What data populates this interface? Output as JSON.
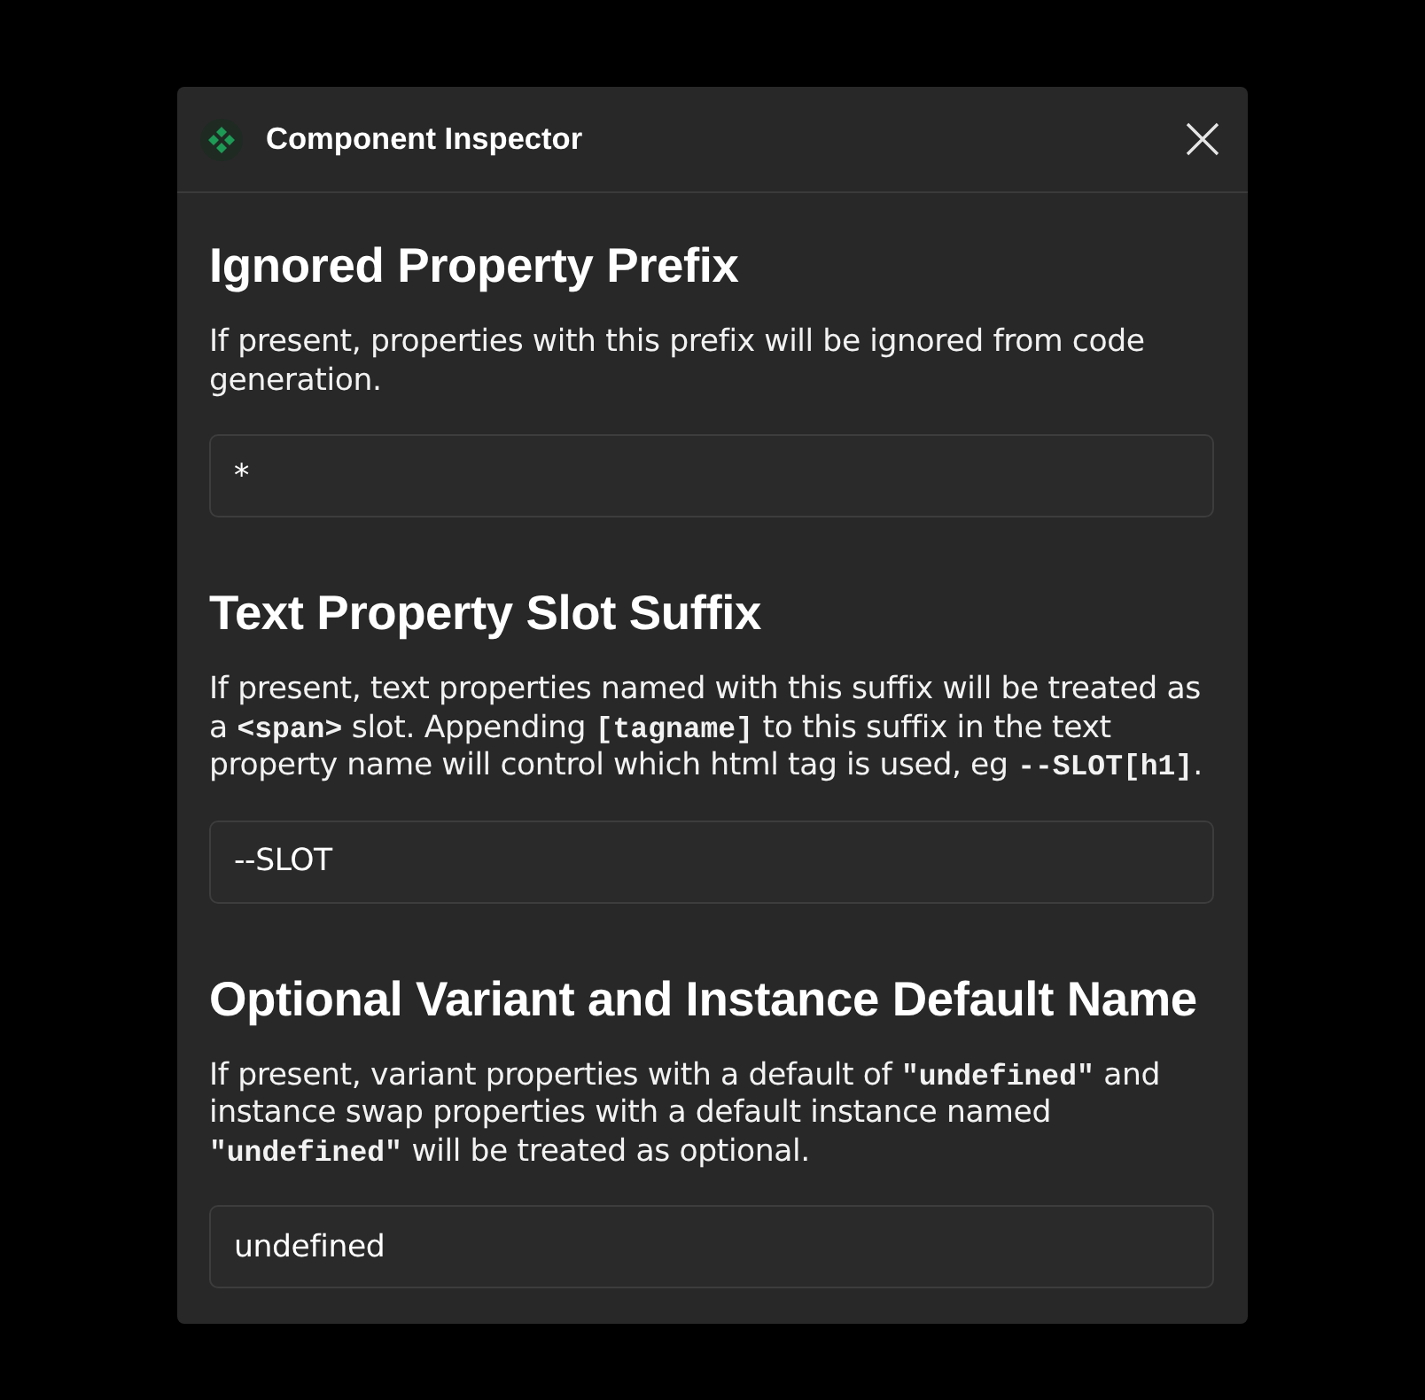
{
  "window": {
    "title": "Component Inspector"
  },
  "sections": [
    {
      "heading": "Ignored Property Prefix",
      "description": [
        {
          "kind": "text",
          "text": "If present, properties with this prefix will be ignored from code generation."
        }
      ],
      "field": {
        "value": "*"
      }
    },
    {
      "heading": "Text Property Slot Suffix",
      "description": [
        {
          "kind": "text",
          "text": "If present, text properties named with this suffix will be treated as a "
        },
        {
          "kind": "code",
          "text": "<span>"
        },
        {
          "kind": "text",
          "text": " slot. Appending "
        },
        {
          "kind": "code",
          "text": "[tagname]"
        },
        {
          "kind": "text",
          "text": " to this suffix in the text property name will control which html tag is used, eg "
        },
        {
          "kind": "code",
          "text": "--SLOT[h1]"
        },
        {
          "kind": "text",
          "text": "."
        }
      ],
      "field": {
        "value": "--SLOT"
      }
    },
    {
      "heading": "Optional Variant and Instance Default Name",
      "description": [
        {
          "kind": "text",
          "text": "If present, variant properties with a default of "
        },
        {
          "kind": "code",
          "text": "\"undefined\""
        },
        {
          "kind": "text",
          "text": " and instance swap properties with a default instance named "
        },
        {
          "kind": "code",
          "text": "\"undefined\""
        },
        {
          "kind": "text",
          "text": " will be treated as optional."
        }
      ],
      "field": {
        "value": "undefined"
      }
    }
  ]
}
